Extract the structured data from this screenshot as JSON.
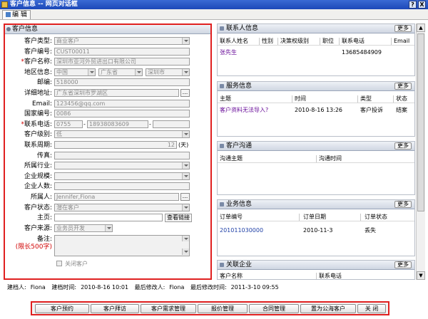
{
  "window": {
    "title": "客户信息 -- 网页对话框",
    "btn_help": "?",
    "btn_close": "X"
  },
  "toolbar": {
    "edit_label": "编 辑"
  },
  "form": {
    "section_title": "客户信息",
    "customer_type": {
      "label": "客户类型:",
      "value": "商业客户"
    },
    "customer_no": {
      "label": "客户编号:",
      "value": "CUST00011"
    },
    "customer_name": {
      "label": "客户名称:",
      "value": "深圳市亚河外贸进出口有限公司"
    },
    "region": {
      "label": "地区信息:",
      "country": "中国",
      "province": "广东省",
      "city": "深圳市"
    },
    "postcode": {
      "label": "邮编:",
      "value": "518000"
    },
    "address": {
      "label": "详细地址:",
      "value": "广东省深圳市罗湖区",
      "btn": "..."
    },
    "email": {
      "label": "Email:",
      "value": "123456@qq.com"
    },
    "country_code": {
      "label": "国家编号:",
      "value": "0086"
    },
    "phone": {
      "label": "联系电话:",
      "area": "0755",
      "number": "18938083609",
      "dash": "-"
    },
    "level": {
      "label": "客户级别:",
      "value": "低"
    },
    "period": {
      "label": "联系周期:",
      "value": "12",
      "unit": "(天)"
    },
    "fax": {
      "label": "传真:"
    },
    "industry": {
      "label": "所属行业:"
    },
    "scale": {
      "label": "企业规模:"
    },
    "headcount": {
      "label": "企业人数:"
    },
    "owner": {
      "label": "所属人:",
      "value": "Jennifer,Fiona",
      "btn": "..."
    },
    "status": {
      "label": "客户状态:",
      "value": "潜在客户"
    },
    "homepage": {
      "label": "主页:",
      "btn": "查看链接"
    },
    "source": {
      "label": "客户来源:",
      "value": "业务员开发"
    },
    "remark": {
      "label": "备注:",
      "limit": "(限长500字)"
    },
    "closed": {
      "label": "关闭客户"
    }
  },
  "contacts": {
    "title": "联系人信息",
    "more": "更多",
    "columns": [
      "联系人姓名",
      "性别",
      "决策权级别",
      "职位",
      "联系电话",
      "Email"
    ],
    "rows": [
      {
        "name": "张先生",
        "phone": "13685484909"
      }
    ]
  },
  "services": {
    "title": "服务信息",
    "more": "更多",
    "columns": [
      "主题",
      "时间",
      "类型",
      "状态"
    ],
    "rows": [
      {
        "subject": "客户资料无法导入?",
        "time": "2010-8-16 13:26",
        "type": "客户投诉",
        "status": "结案"
      }
    ]
  },
  "communication": {
    "title": "客户沟通",
    "more": "更多",
    "columns": [
      "沟通主题",
      "沟通时间"
    ]
  },
  "business": {
    "title": "业务信息",
    "more": "更多",
    "columns": [
      "订单编号",
      "订单日期",
      "订单状态"
    ],
    "rows": [
      {
        "order_no": "201011030000",
        "date": "2010-11-3",
        "status": "丢失"
      }
    ]
  },
  "related": {
    "title": "关联企业",
    "more": "更多",
    "columns": [
      "客户名称",
      "联系电话"
    ]
  },
  "meta": {
    "creator_label": "建档人:",
    "creator": "Fiona",
    "created_label": "建档时间:",
    "created": "2010-8-16 10:01",
    "modifier_label": "最后修改人:",
    "modifier": "Fiona",
    "modified_label": "最后修改时间:",
    "modified": "2011-3-10 09:55"
  },
  "actions": {
    "appointment": "客户预约",
    "visit": "客户拜访",
    "needs": "客户需求管理",
    "quote": "报价管理",
    "contract": "合同管理",
    "to_public": "置为公海客户",
    "close": "关 闭"
  }
}
